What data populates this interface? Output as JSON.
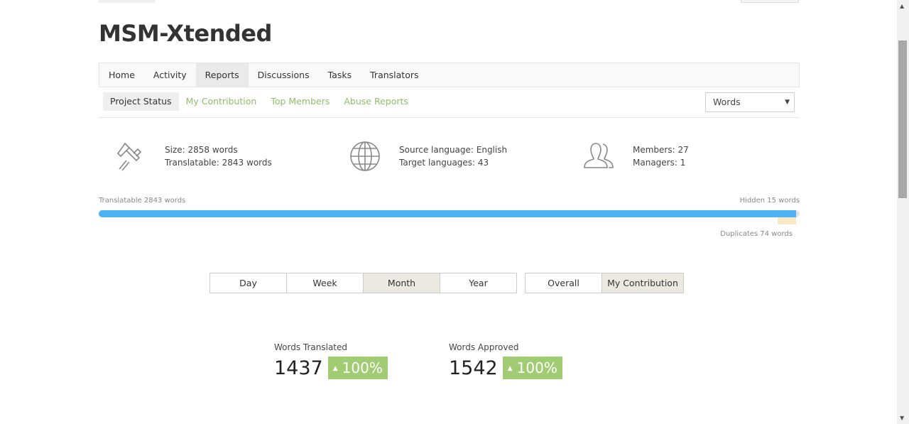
{
  "project": {
    "title": "MSM-Xtended"
  },
  "nav": {
    "items": [
      {
        "label": "Home"
      },
      {
        "label": "Activity"
      },
      {
        "label": "Reports",
        "active": true
      },
      {
        "label": "Discussions"
      },
      {
        "label": "Tasks"
      },
      {
        "label": "Translators"
      }
    ]
  },
  "subnav": {
    "items": [
      {
        "label": "Project Status",
        "active": true
      },
      {
        "label": "My Contribution"
      },
      {
        "label": "Top Members"
      },
      {
        "label": "Abuse Reports"
      }
    ],
    "unit_select": "Words"
  },
  "stats": {
    "size": {
      "icon": "caliper-icon",
      "line1": "Size: 2858 words",
      "line2": "Translatable: 2843 words"
    },
    "languages": {
      "icon": "globe-icon",
      "line1": "Source language: English",
      "line2": "Target languages: 43"
    },
    "members": {
      "icon": "users-icon",
      "line1": "Members: 27",
      "line2": "Managers: 1"
    }
  },
  "progress": {
    "translatable_label": "Translatable 2843 words",
    "hidden_label": "Hidden 15 words",
    "duplicates_label": "Duplicates 74 words",
    "translatable_words": 2843,
    "hidden_words": 15,
    "duplicate_words": 74,
    "total_words": 2858,
    "colors": {
      "translatable": "#4db3f5",
      "duplicates": "#f7e9c8",
      "hidden": "#e2e2e2"
    }
  },
  "periods": {
    "items": [
      {
        "label": "Day"
      },
      {
        "label": "Week"
      },
      {
        "label": "Month",
        "active": true
      },
      {
        "label": "Year"
      }
    ],
    "scope": [
      {
        "label": "Overall"
      },
      {
        "label": "My Contribution",
        "active": true
      }
    ]
  },
  "metrics": [
    {
      "label": "Words Translated",
      "value": "1437",
      "change": "100%"
    },
    {
      "label": "Words Approved",
      "value": "1542",
      "change": "100%"
    }
  ],
  "colors": {
    "accent_green": "#a1cc73",
    "link_green": "#8fbf68"
  }
}
